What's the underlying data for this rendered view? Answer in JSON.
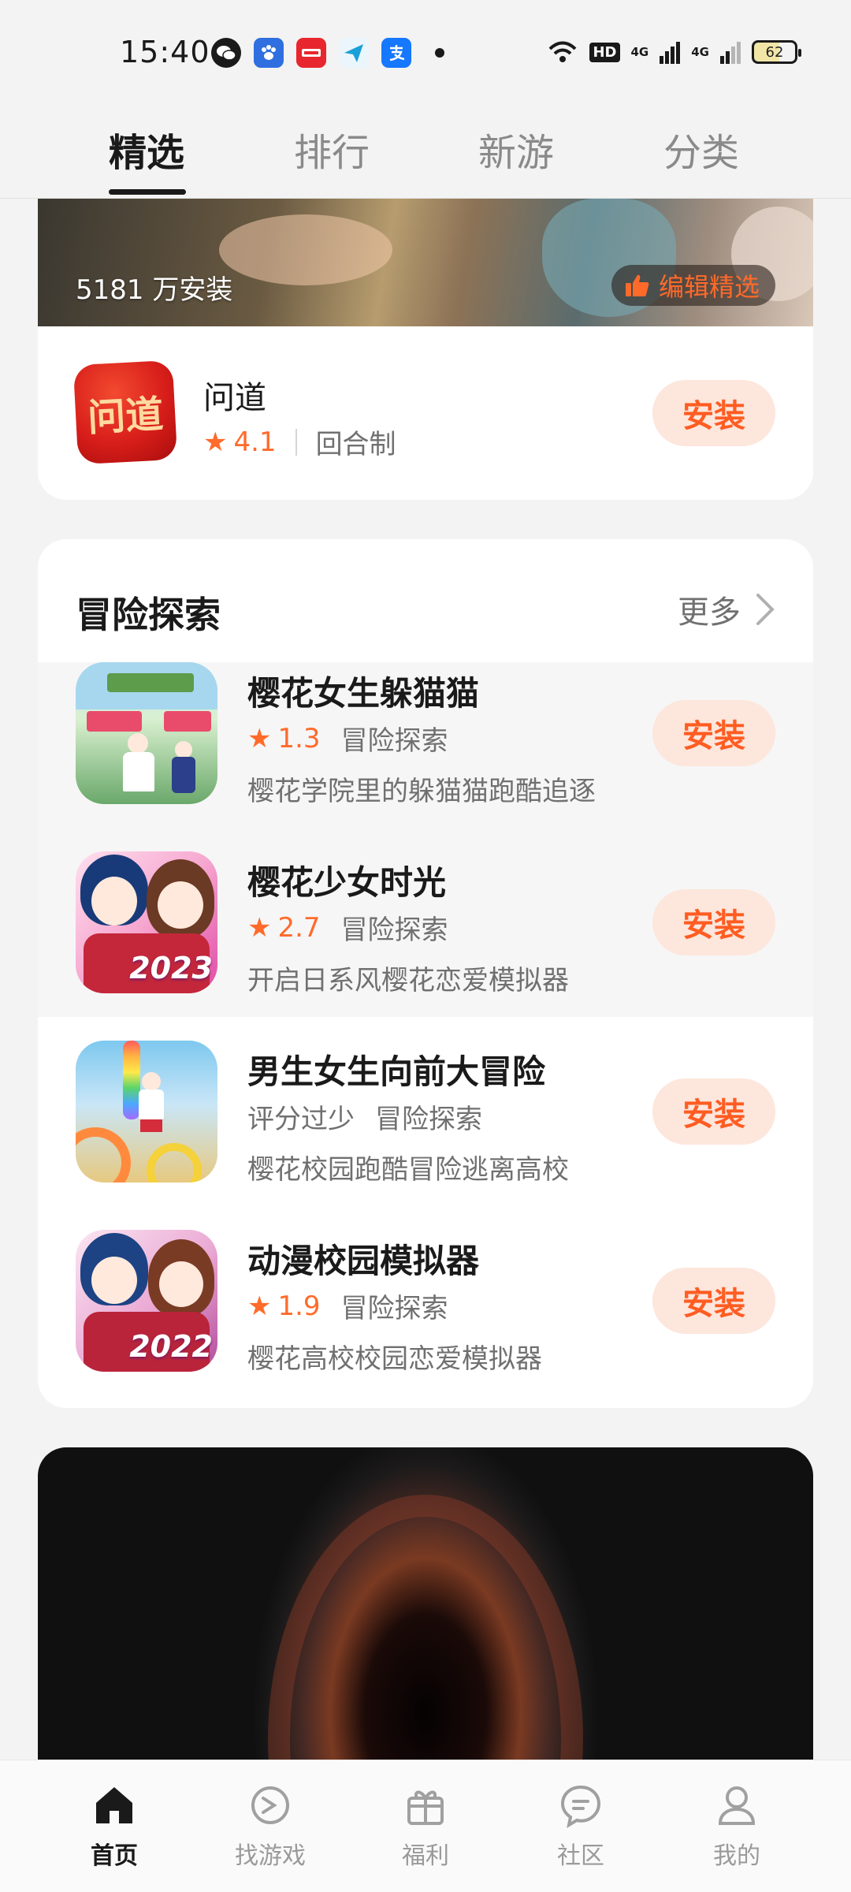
{
  "status_bar": {
    "time": "15:40",
    "battery": "62",
    "network": "4G",
    "hd": "HD"
  },
  "top_tabs": [
    {
      "label": "精选",
      "active": true
    },
    {
      "label": "排行",
      "active": false
    },
    {
      "label": "新游",
      "active": false
    },
    {
      "label": "分类",
      "active": false
    }
  ],
  "banner": {
    "installs": "5181 万安装",
    "editor_pick": "编辑精选"
  },
  "featured_game": {
    "icon_text": "问道",
    "name": "问道",
    "rating": "4.1",
    "category": "回合制",
    "install_label": "安装"
  },
  "section": {
    "title": "冒险探索",
    "more_label": "更多",
    "games": [
      {
        "name": "樱花女生躲猫猫",
        "rating": "1.3",
        "category": "冒险探索",
        "description": "樱花学院里的躲猫猫跑酷追逐",
        "install_label": "安装"
      },
      {
        "name": "樱花少女时光",
        "rating": "2.7",
        "category": "冒险探索",
        "description": "开启日系风樱花恋爱模拟器",
        "install_label": "安装",
        "icon_badge": "2023"
      },
      {
        "name": "男生女生向前大冒险",
        "rating_text": "评分过少",
        "category": "冒险探索",
        "description": "樱花校园跑酷冒险逃离高校",
        "install_label": "安装"
      },
      {
        "name": "动漫校园模拟器",
        "rating": "1.9",
        "category": "冒险探索",
        "description": "樱花高校校园恋爱模拟器",
        "install_label": "安装",
        "icon_badge": "2022"
      }
    ]
  },
  "bottom_nav": [
    {
      "label": "首页",
      "icon": "home-icon",
      "active": true
    },
    {
      "label": "找游戏",
      "icon": "find-game-icon",
      "active": false
    },
    {
      "label": "福利",
      "icon": "gift-icon",
      "active": false
    },
    {
      "label": "社区",
      "icon": "community-icon",
      "active": false
    },
    {
      "label": "我的",
      "icon": "profile-icon",
      "active": false
    }
  ],
  "colors": {
    "accent": "#ff5c22",
    "install_bg": "#fde6dc",
    "star": "#ff6b2b"
  }
}
